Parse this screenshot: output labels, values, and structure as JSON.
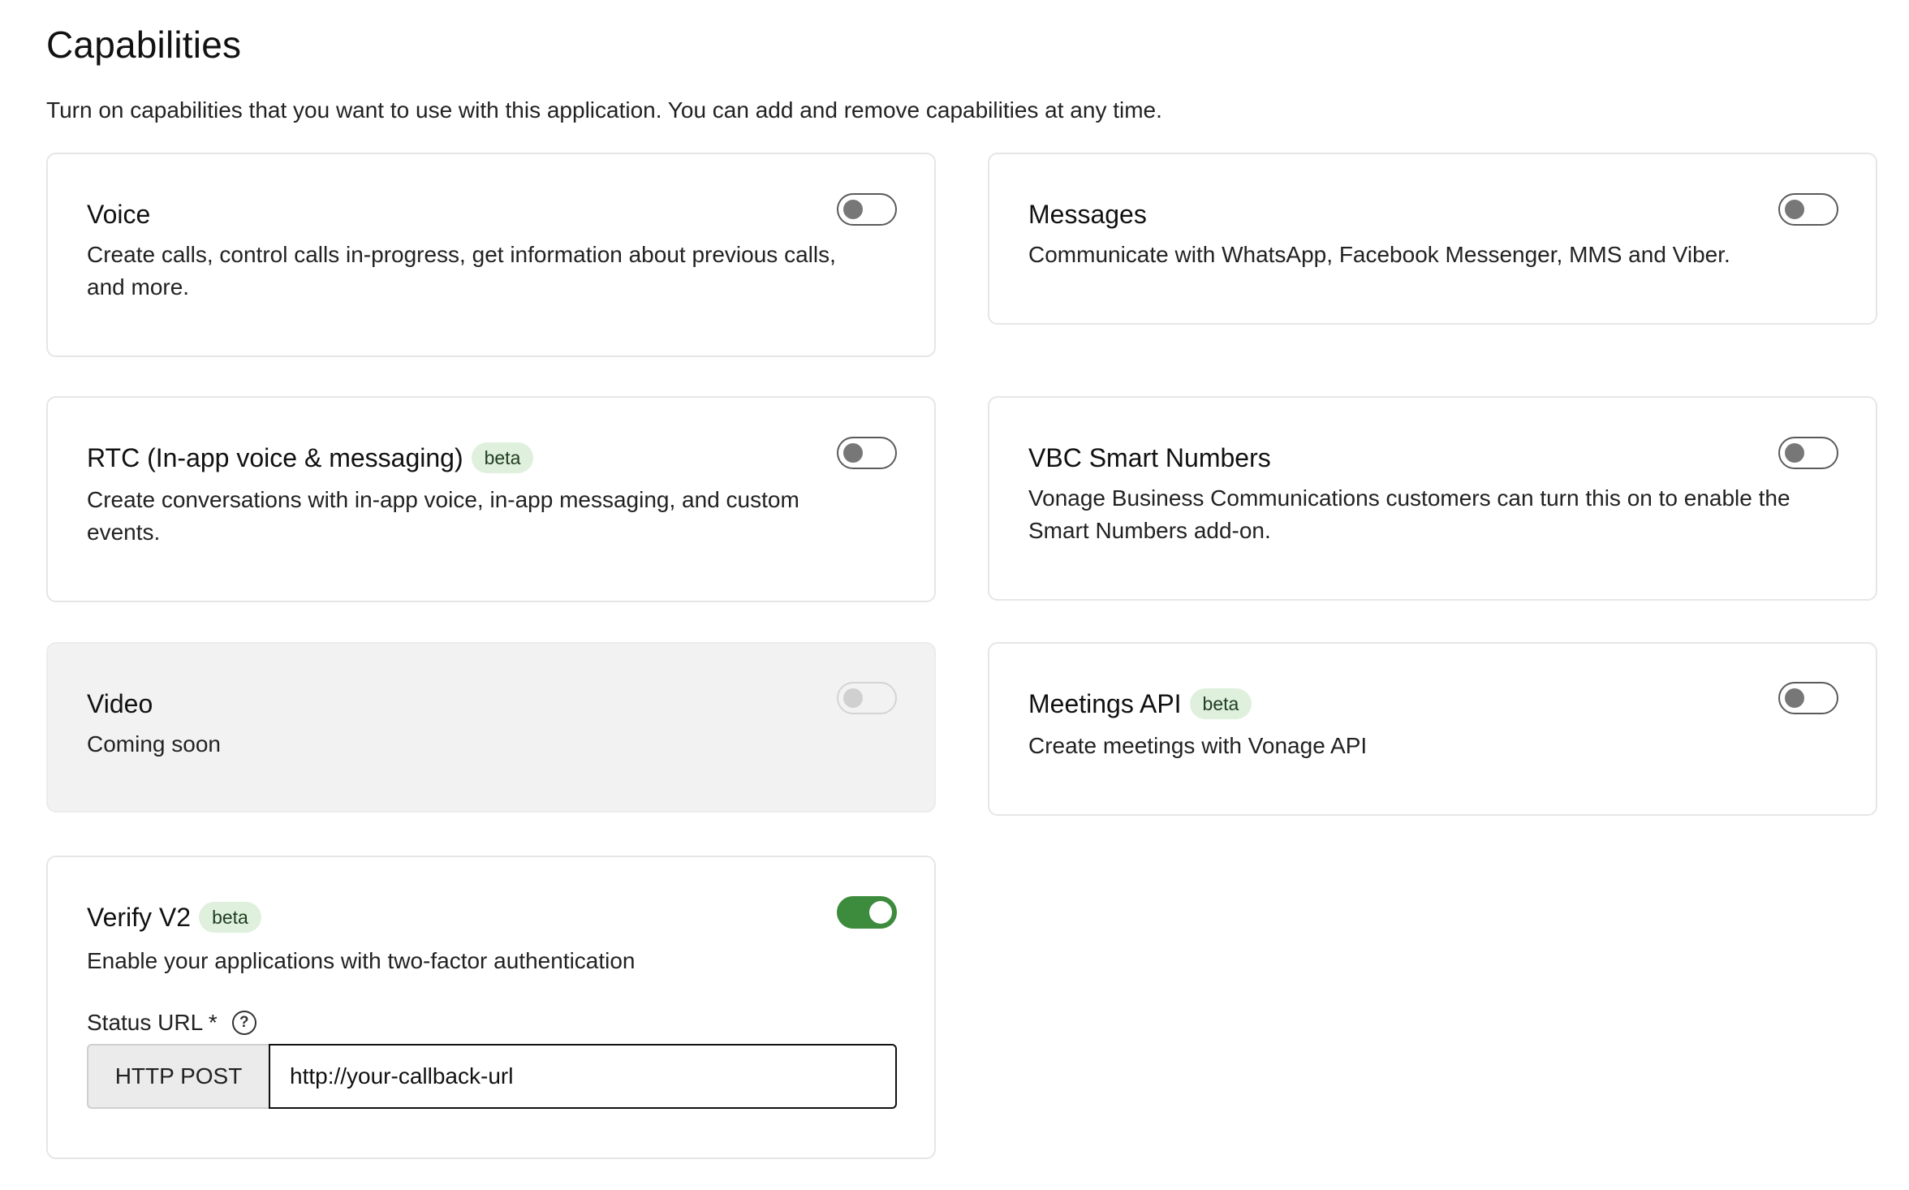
{
  "page": {
    "title": "Capabilities",
    "subtitle": "Turn on capabilities that you want to use with this application. You can add and remove capabilities at any time."
  },
  "capabilities": {
    "voice": {
      "title": "Voice",
      "description_line1": "Create calls, control calls in-progress, get information about previous calls,",
      "description_line2": "and more.",
      "enabled": false
    },
    "messages": {
      "title": "Messages",
      "description": "Communicate with WhatsApp, Facebook Messenger, MMS and Viber.",
      "enabled": false
    },
    "rtc": {
      "title": "RTC (In-app voice & messaging)",
      "badge": "beta",
      "description_line1": "Create conversations with in-app voice, in-app messaging, and custom",
      "description_line2": "events.",
      "enabled": false
    },
    "vbc": {
      "title": "VBC Smart Numbers",
      "description_line1": "Vonage Business Communications customers can turn this on to enable the",
      "description_line2": "Smart Numbers add-on.",
      "enabled": false
    },
    "video": {
      "title": "Video",
      "description": "Coming soon",
      "enabled": false,
      "disabled": true
    },
    "meetings": {
      "title": "Meetings API",
      "badge": "beta",
      "description": "Create meetings with Vonage API",
      "enabled": false
    },
    "verify": {
      "title": "Verify V2",
      "badge": "beta",
      "description": "Enable your applications with two-factor authentication",
      "enabled": true,
      "status_url": {
        "label": "Status URL *",
        "method": "HTTP POST",
        "value": "http://your-callback-url"
      }
    }
  },
  "colors": {
    "toggle_on": "#3d8b3d",
    "beta_bg": "#dff0dd",
    "card_border": "#e6e6e6",
    "disabled_bg": "#f2f2f2"
  },
  "icons": {
    "help": "question-circle-icon"
  }
}
